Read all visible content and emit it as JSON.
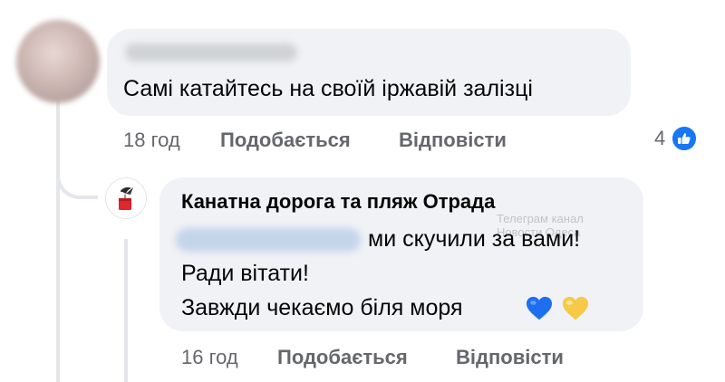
{
  "comment": {
    "text": "Самі катайтесь на своїй іржавій залізці",
    "time": "18 год",
    "like_label": "Подобається",
    "reply_label": "Відповісти",
    "reaction_count": "4"
  },
  "reply": {
    "author": "Канатна дорога та пляж Отрада",
    "watermark_line1": "Телеграм канал",
    "watermark_line2": "Новости Одеса",
    "line1": "ми скучили за вами!",
    "line2": "Ради вітати!",
    "line3": "Завжди чекаємо біля моря",
    "time": "16 год",
    "like_label": "Подобається",
    "reply_label": "Відповісти"
  },
  "colors": {
    "bubble": "#f0f2f5",
    "secondary_text": "#65676b",
    "like_blue": "#1877f2",
    "blue_heart": "#1e6ff0",
    "yellow_heart": "#f7c948"
  },
  "icons": {
    "reaction": "like-thumb-icon",
    "blue_heart": "blue-heart-emoji",
    "yellow_heart": "yellow-heart-emoji"
  }
}
